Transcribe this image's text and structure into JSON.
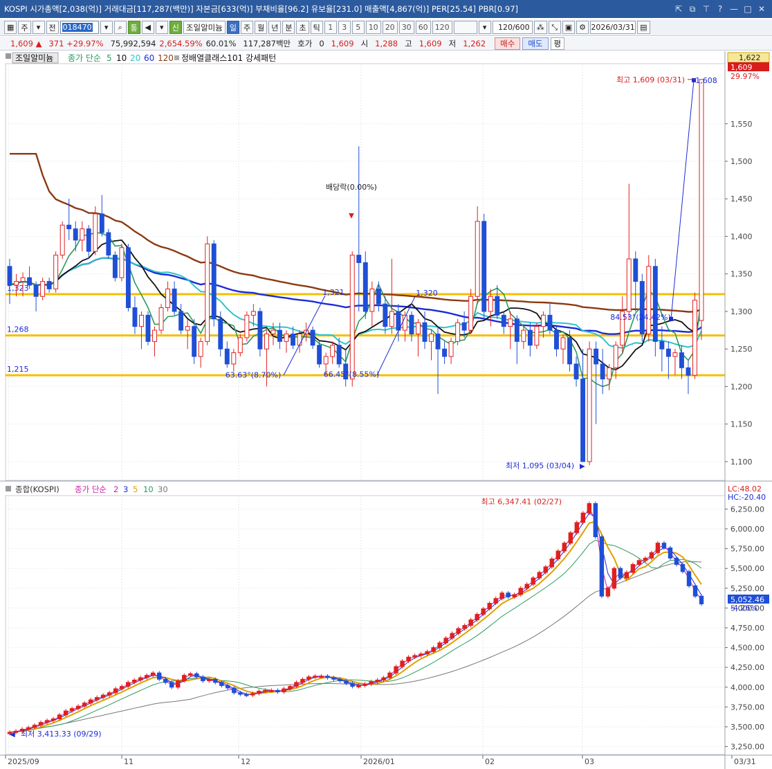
{
  "window": {
    "title": "KOSPI 시가총액[2,038(억)] 거래대금[117,287(백만)] 자본금[633(억)] 부채비율[96.2] 유보율[231.0] 매출액[4,867(억)] PER[25.54] PBR[0.97]"
  },
  "toolbar": {
    "market_type": "주",
    "prev_label": "전",
    "code": "018470",
    "flags": [
      "통",
      "신"
    ],
    "stock_name": "조일알미늄",
    "periods": [
      "일",
      "주",
      "월",
      "년",
      "분",
      "초",
      "틱"
    ],
    "selected_period": "일",
    "intervals": [
      "1",
      "3",
      "5",
      "10",
      "20",
      "30",
      "60",
      "120"
    ],
    "count": "120/600",
    "date": "2026/03/31"
  },
  "quote": {
    "price": "1,609",
    "change": "371",
    "change_pct": "+29.97%",
    "volume": "75,992,594",
    "volume_ratio": "2,654.59%",
    "turnover_rate": "60.01%",
    "amount": "117,287백만",
    "hoga_label": "호가",
    "hoga_value": "0",
    "hoga_price": "1,609",
    "open_label": "시",
    "open": "1,288",
    "high_label": "고",
    "high": "1,609",
    "low_label": "저",
    "low": "1,262",
    "buy_label": "매수",
    "sell_label": "매도",
    "even_label": "평"
  },
  "upper_legend": {
    "name": "조일알미늄",
    "ma_label": "종가 단순",
    "ma_periods": [
      "5",
      "10",
      "20",
      "60",
      "120"
    ],
    "pattern": "정배열클래스101 강세패턴"
  },
  "lower_legend": {
    "name": "종합(KOSPI)",
    "ma_label": "종가 단순",
    "ma_periods": [
      "2",
      "3",
      "5",
      "10",
      "30"
    ]
  },
  "colors": {
    "up": "#e0201f",
    "down": "#1f4fd6",
    "ma5": "#2a9a5c",
    "ma10": "#111111",
    "ma20": "#2fc3c9",
    "ma60": "#1b2bd8",
    "ma120": "#8b3a10",
    "support": "#f4bf00"
  },
  "chart_data": [
    {
      "type": "candlestick",
      "title": "조일알미늄",
      "y_ticks": [
        "1,550",
        "1,500",
        "1,450",
        "1,400",
        "1,350",
        "1,300",
        "1,250",
        "1,200",
        "1,150",
        "1,100"
      ],
      "ylim": [
        1075,
        1630
      ],
      "price_labels": [
        "1,622",
        "1,609",
        "29.97%"
      ],
      "x_labels": [
        "2025/09",
        "11",
        "12",
        "2026/01",
        "02",
        "03",
        "03/31"
      ],
      "ohlc": [
        [
          1360,
          1370,
          1310,
          1335
        ],
        [
          1335,
          1350,
          1320,
          1340
        ],
        [
          1340,
          1352,
          1320,
          1345
        ],
        [
          1345,
          1360,
          1330,
          1335
        ],
        [
          1335,
          1340,
          1300,
          1320
        ],
        [
          1320,
          1345,
          1315,
          1340
        ],
        [
          1340,
          1345,
          1325,
          1330
        ],
        [
          1330,
          1380,
          1325,
          1375
        ],
        [
          1375,
          1420,
          1370,
          1415
        ],
        [
          1415,
          1450,
          1395,
          1410
        ],
        [
          1410,
          1420,
          1380,
          1395
        ],
        [
          1395,
          1420,
          1380,
          1410
        ],
        [
          1410,
          1415,
          1370,
          1380
        ],
        [
          1380,
          1440,
          1375,
          1430
        ],
        [
          1430,
          1455,
          1400,
          1405
        ],
        [
          1405,
          1410,
          1370,
          1375
        ],
        [
          1375,
          1380,
          1340,
          1345
        ],
        [
          1345,
          1390,
          1340,
          1385
        ],
        [
          1385,
          1390,
          1300,
          1305
        ],
        [
          1305,
          1320,
          1270,
          1280
        ],
        [
          1280,
          1300,
          1250,
          1295
        ],
        [
          1295,
          1300,
          1255,
          1260
        ],
        [
          1260,
          1280,
          1240,
          1275
        ],
        [
          1275,
          1310,
          1270,
          1305
        ],
        [
          1305,
          1340,
          1300,
          1330
        ],
        [
          1330,
          1340,
          1295,
          1300
        ],
        [
          1300,
          1310,
          1270,
          1275
        ],
        [
          1275,
          1290,
          1250,
          1280
        ],
        [
          1280,
          1290,
          1230,
          1240
        ],
        [
          1240,
          1265,
          1225,
          1260
        ],
        [
          1260,
          1400,
          1255,
          1390
        ],
        [
          1390,
          1395,
          1280,
          1290
        ],
        [
          1290,
          1300,
          1240,
          1250
        ],
        [
          1250,
          1260,
          1225,
          1230
        ],
        [
          1230,
          1250,
          1220,
          1245
        ],
        [
          1245,
          1270,
          1240,
          1265
        ],
        [
          1265,
          1300,
          1260,
          1295
        ],
        [
          1295,
          1310,
          1280,
          1300
        ],
        [
          1300,
          1305,
          1240,
          1250
        ],
        [
          1250,
          1275,
          1200,
          1270
        ],
        [
          1270,
          1285,
          1255,
          1275
        ],
        [
          1275,
          1285,
          1250,
          1260
        ],
        [
          1260,
          1275,
          1245,
          1270
        ],
        [
          1270,
          1280,
          1250,
          1255
        ],
        [
          1255,
          1275,
          1245,
          1270
        ],
        [
          1270,
          1285,
          1260,
          1275
        ],
        [
          1275,
          1280,
          1250,
          1255
        ],
        [
          1255,
          1262,
          1225,
          1230
        ],
        [
          1230,
          1245,
          1215,
          1240
        ],
        [
          1240,
          1260,
          1230,
          1255
        ],
        [
          1255,
          1265,
          1225,
          1230
        ],
        [
          1230,
          1250,
          1200,
          1210
        ],
        [
          1210,
          1380,
          1200,
          1375
        ],
        [
          1375,
          1520,
          1300,
          1365
        ],
        [
          1365,
          1380,
          1290,
          1300
        ],
        [
          1300,
          1340,
          1280,
          1330
        ],
        [
          1330,
          1340,
          1300,
          1310
        ],
        [
          1310,
          1320,
          1270,
          1280
        ],
        [
          1280,
          1370,
          1270,
          1300
        ],
        [
          1300,
          1310,
          1260,
          1275
        ],
        [
          1275,
          1300,
          1260,
          1295
        ],
        [
          1295,
          1300,
          1260,
          1270
        ],
        [
          1270,
          1290,
          1240,
          1285
        ],
        [
          1285,
          1300,
          1250,
          1260
        ],
        [
          1260,
          1275,
          1235,
          1270
        ],
        [
          1270,
          1280,
          1190,
          1250
        ],
        [
          1250,
          1260,
          1230,
          1240
        ],
        [
          1240,
          1265,
          1230,
          1260
        ],
        [
          1260,
          1290,
          1255,
          1285
        ],
        [
          1285,
          1300,
          1265,
          1275
        ],
        [
          1275,
          1330,
          1270,
          1320
        ],
        [
          1320,
          1440,
          1310,
          1420
        ],
        [
          1420,
          1430,
          1290,
          1300
        ],
        [
          1300,
          1330,
          1280,
          1320
        ],
        [
          1320,
          1335,
          1290,
          1295
        ],
        [
          1295,
          1300,
          1270,
          1280
        ],
        [
          1280,
          1300,
          1250,
          1290
        ],
        [
          1290,
          1295,
          1230,
          1260
        ],
        [
          1260,
          1280,
          1250,
          1275
        ],
        [
          1275,
          1285,
          1240,
          1255
        ],
        [
          1255,
          1285,
          1250,
          1280
        ],
        [
          1280,
          1300,
          1265,
          1295
        ],
        [
          1295,
          1310,
          1270,
          1275
        ],
        [
          1275,
          1280,
          1240,
          1250
        ],
        [
          1250,
          1270,
          1230,
          1265
        ],
        [
          1265,
          1275,
          1220,
          1230
        ],
        [
          1230,
          1240,
          1200,
          1210
        ],
        [
          1210,
          1250,
          1100,
          1100
        ],
        [
          1100,
          1260,
          1095,
          1250
        ],
        [
          1250,
          1260,
          1150,
          1230
        ],
        [
          1230,
          1250,
          1190,
          1210
        ],
        [
          1210,
          1230,
          1195,
          1225
        ],
        [
          1225,
          1260,
          1210,
          1255
        ],
        [
          1255,
          1320,
          1245,
          1300
        ],
        [
          1300,
          1470,
          1290,
          1370
        ],
        [
          1370,
          1380,
          1300,
          1340
        ],
        [
          1340,
          1350,
          1260,
          1270
        ],
        [
          1270,
          1375,
          1260,
          1360
        ],
        [
          1360,
          1370,
          1240,
          1260
        ],
        [
          1260,
          1280,
          1220,
          1250
        ],
        [
          1250,
          1260,
          1210,
          1240
        ],
        [
          1240,
          1250,
          1215,
          1245
        ],
        [
          1245,
          1255,
          1210,
          1225
        ],
        [
          1225,
          1235,
          1190,
          1215
        ],
        [
          1215,
          1325,
          1210,
          1315
        ],
        [
          1288,
          1609,
          1262,
          1609
        ]
      ],
      "annotations": [
        {
          "label": "최고 1,609 (03/31)",
          "value": 1609
        },
        {
          "label": "최저 1,095 (03/04)",
          "value": 1095
        },
        {
          "label": "배당락(0.00%)"
        },
        {
          "label": "1,321"
        },
        {
          "label": "1,320"
        },
        {
          "label": "1,608"
        },
        {
          "label": "63.63°(8.70%)"
        },
        {
          "label": "66.45°(8.55%)"
        },
        {
          "label": "84.53°(24.42%)"
        }
      ],
      "support_lines": [
        {
          "label": "1,323",
          "value": 1323
        },
        {
          "label": "1,268",
          "value": 1268
        },
        {
          "label": "1,215",
          "value": 1215
        }
      ]
    },
    {
      "type": "candlestick",
      "title": "종합(KOSPI)",
      "y_ticks": [
        "6,250.00",
        "6,000.00",
        "5,750.00",
        "5,500.00",
        "5,250.00",
        "5,000.00",
        "4,750.00",
        "4,500.00",
        "4,250.00",
        "4,000.00",
        "3,750.00",
        "3,500.00",
        "3,250.00"
      ],
      "ylim": [
        3150,
        6420
      ],
      "price_labels": [
        "LC:48.02",
        "HC:-20.40",
        "5,052.46",
        "-4.26%"
      ],
      "closes": [
        3430,
        3445,
        3470,
        3490,
        3520,
        3555,
        3580,
        3600,
        3650,
        3700,
        3730,
        3760,
        3800,
        3840,
        3870,
        3900,
        3930,
        3980,
        4010,
        4060,
        4090,
        4120,
        4150,
        4180,
        4100,
        4060,
        4000,
        4080,
        4150,
        4170,
        4130,
        4080,
        4100,
        4060,
        4020,
        3990,
        3930,
        3910,
        3900,
        3920,
        3950,
        3960,
        3960,
        3940,
        3980,
        4010,
        4060,
        4100,
        4130,
        4140,
        4140,
        4120,
        4100,
        4080,
        4050,
        4010,
        4020,
        4040,
        4070,
        4090,
        4120,
        4180,
        4260,
        4330,
        4380,
        4400,
        4420,
        4450,
        4500,
        4560,
        4620,
        4680,
        4740,
        4780,
        4850,
        4920,
        4990,
        5060,
        5120,
        5190,
        5140,
        5170,
        5250,
        5300,
        5380,
        5450,
        5520,
        5620,
        5720,
        5820,
        5950,
        6080,
        6200,
        6320,
        5900,
        5150,
        5250,
        5500,
        5380,
        5450,
        5550,
        5600,
        5630,
        5700,
        5820,
        5760,
        5630,
        5550,
        5460,
        5280,
        5150,
        5052
      ],
      "annotations": [
        {
          "label": "최고 6,347.41 (02/27)",
          "value": 6347.41
        },
        {
          "label": "최저 3,413.33 (09/29)",
          "value": 3413.33
        }
      ]
    }
  ]
}
